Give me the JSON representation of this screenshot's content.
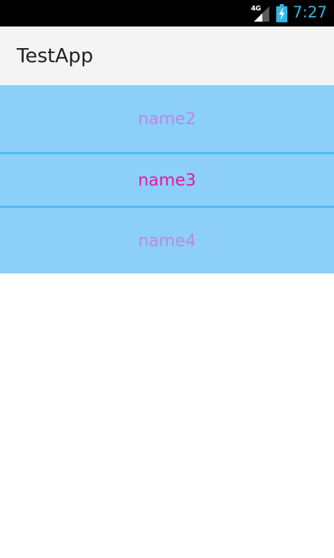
{
  "status_bar": {
    "network": "4G",
    "time": "7:27",
    "icons": [
      "signal-icon",
      "battery-charging-icon"
    ],
    "time_color": "#33b5e5"
  },
  "action_bar": {
    "title": "TestApp"
  },
  "list": {
    "items": [
      {
        "label": "name2",
        "color": "#b88ae3"
      },
      {
        "label": "name3",
        "color": "#e01ba6"
      },
      {
        "label": "name4",
        "color": "#b88ae3"
      }
    ],
    "background_color": "#8ccff9",
    "divider_color": "#4cbaf0"
  }
}
